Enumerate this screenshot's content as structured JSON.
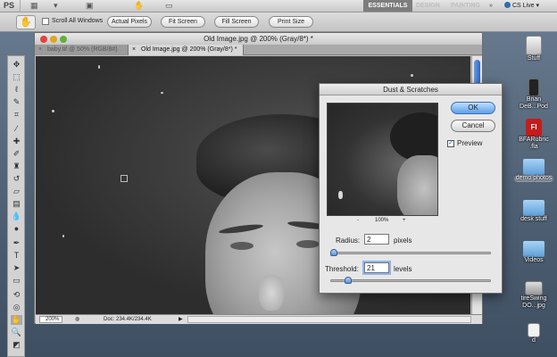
{
  "appbar": {
    "app_short": "PS",
    "workspaces": [
      "ESSENTIALS",
      "DESIGN",
      "PAINTING"
    ],
    "more": "»",
    "cs_live": "CS Live"
  },
  "options": {
    "scroll_all_windows": "Scroll All Windows",
    "buttons": [
      "Actual Pixels",
      "Fit Screen",
      "Fill Screen",
      "Print Size"
    ]
  },
  "document": {
    "title": "Old Image.jpg @ 200% (Gray/8*) *",
    "tabs": [
      {
        "label": "baby.tif @ 50% (RGB/8#)",
        "close": "×",
        "active": false
      },
      {
        "label": "Old Image.jpg @ 200% (Gray/8*) *",
        "close": "×",
        "active": true
      }
    ],
    "zoom": "200%",
    "doc_info": "Doc: 234.4K/234.4K"
  },
  "dialog": {
    "title": "Dust & Scratches",
    "ok": "OK",
    "cancel": "Cancel",
    "preview_label": "Preview",
    "preview_checked": true,
    "zoom_minus": "-",
    "zoom_value": "100%",
    "zoom_plus": "+",
    "radius_label": "Radius:",
    "radius_value": "2",
    "radius_unit": "pixels",
    "threshold_label": "Threshold:",
    "threshold_value": "21",
    "threshold_unit": "levels"
  },
  "desktop": {
    "items": [
      {
        "label": "Stuff",
        "icon": "drive-icon"
      },
      {
        "label": "Brian DeB...Pod",
        "icon": "ipod-icon"
      },
      {
        "label": "BFARubric .fla",
        "icon": "flash-file-icon"
      },
      {
        "label": "demo photos",
        "icon": "folder-icon"
      },
      {
        "label": "desk stuff",
        "icon": "folder-icon"
      },
      {
        "label": "Videos",
        "icon": "folder-icon"
      },
      {
        "label": "tireSwing DO...jpg",
        "icon": "image-file-icon"
      },
      {
        "label": "d",
        "icon": "file-icon"
      }
    ]
  },
  "colors": {
    "accent": "#5e9fe6",
    "desktop_bg": "#5a6a7e"
  }
}
